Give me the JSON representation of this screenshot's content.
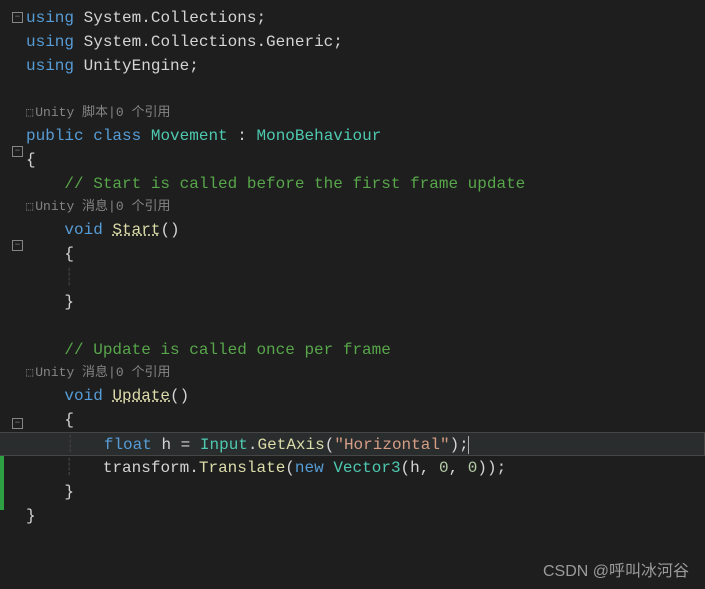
{
  "code": {
    "using1_kw": "using",
    "using1_ns": "System.Collections",
    "using2_kw": "using",
    "using2_ns": "System.Collections.Generic",
    "using3_kw": "using",
    "using3_ns": "UnityEngine",
    "codelens_class": "Unity 脚本|0 个引用",
    "public_kw": "public",
    "class_kw": "class",
    "class_name": "Movement",
    "base_class": "MonoBehaviour",
    "brace_open": "{",
    "brace_close": "}",
    "comment_start": "// Start is called before the first frame update",
    "codelens_start": "Unity 消息|0 个引用",
    "void_kw1": "void",
    "start_method": "Start",
    "parens": "()",
    "comment_update": "// Update is called once per frame",
    "codelens_update": "Unity 消息|0 个引用",
    "void_kw2": "void",
    "update_method": "Update",
    "float_kw": "float",
    "var_h": "h",
    "equals": " = ",
    "input_class": "Input",
    "getaxis": "GetAxis",
    "horizontal_str": "\"Horizontal\"",
    "transform_var": "transform",
    "translate": "Translate",
    "new_kw": "new",
    "vector3": "Vector3",
    "vec_args_h": "h",
    "vec_args_0a": "0",
    "vec_args_0b": "0",
    "semi": ";"
  },
  "watermark": "CSDN @呼叫冰河谷"
}
